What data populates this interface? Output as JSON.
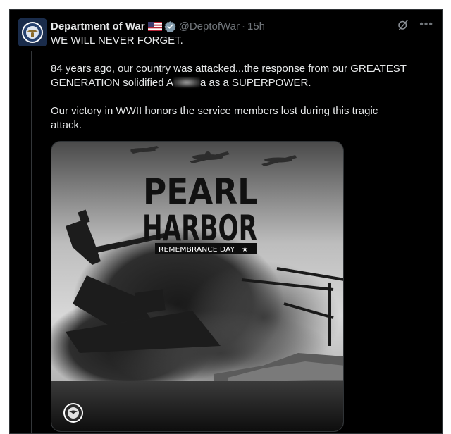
{
  "post": {
    "author_name": "Department of War",
    "handle": "@DeptofWar",
    "separator": "·",
    "time": "15h",
    "flag_icon": "us-flag-icon",
    "verified_icon": "verified-badge-icon",
    "text": {
      "line1": "WE WILL NEVER FORGET.",
      "para2_before": "84 years ago, our country was attacked...the response from our GREATEST GENERATION solidified A",
      "para2_after": "a as a SUPERPOWER.",
      "para3": "Our victory in WWII honors the service members lost during this tragic attack."
    }
  },
  "media": {
    "title_line1": "PEARL",
    "title_line2": "HARBOR",
    "subtitle": "REMEMBRANCE DAY",
    "subtitle_star": "★"
  },
  "colors": {
    "background": "#000000",
    "text": "#e7e9ea",
    "muted": "#71767b",
    "verified": "#829aab"
  }
}
